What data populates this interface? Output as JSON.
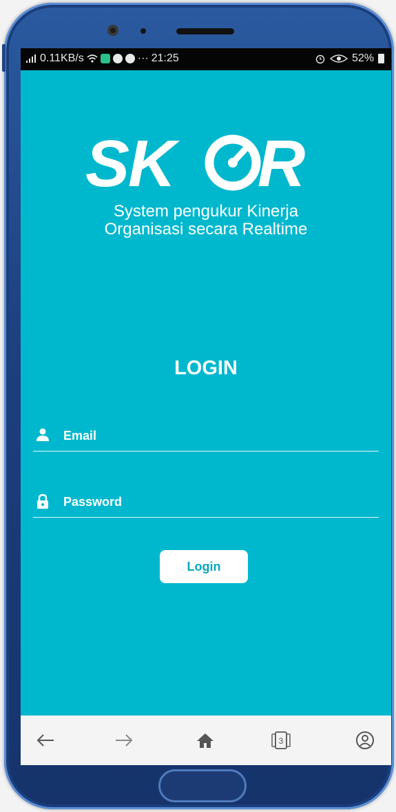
{
  "status_bar": {
    "network_speed": "0.11KB/s",
    "time": "21:25",
    "ellipsis": "···",
    "battery": "52%",
    "icons": [
      "signal-icon",
      "wifi-icon",
      "chat-app-icon",
      "smiley-app-icon",
      "notification-app-icon",
      "alarm-icon",
      "eye-icon",
      "battery-icon"
    ]
  },
  "branding": {
    "logo_text": "SKOR",
    "tagline_line1": "System pengukur Kinerja",
    "tagline_line2": "Organisasi secara Realtime"
  },
  "form": {
    "title": "LOGIN",
    "email_label": "Email",
    "password_label": "Password",
    "submit_label": "Login"
  },
  "browser_nav": {
    "tab_count": "3",
    "items": [
      "back-arrow-icon",
      "forward-arrow-icon",
      "home-icon",
      "tabs-icon",
      "account-icon"
    ]
  },
  "colors": {
    "screen_background": "#00b8cd",
    "phone_body": "#1d3f7d",
    "button_text": "#0aa7bc"
  }
}
